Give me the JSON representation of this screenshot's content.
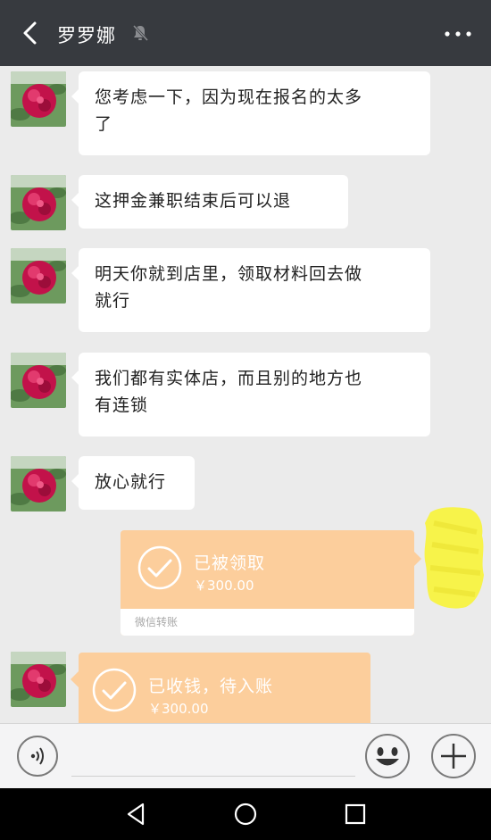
{
  "header": {
    "title": "罗罗娜",
    "back_icon": "back-chevron-icon",
    "mute_icon": "bell-off-icon",
    "more_icon": "more-dots-icon"
  },
  "messages": [
    {
      "type": "text",
      "side": "left",
      "text_lines": [
        "您考虑一下，因为现在报名的太多",
        "了"
      ]
    },
    {
      "type": "text",
      "side": "left",
      "text_lines": [
        "这押金兼职结束后可以退"
      ]
    },
    {
      "type": "text",
      "side": "left",
      "text_lines": [
        "明天你就到店里，领取材料回去做",
        "就行"
      ]
    },
    {
      "type": "text",
      "side": "left",
      "text_lines": [
        "我们都有实体店，而且别的地方也",
        "有连锁"
      ]
    },
    {
      "type": "text",
      "side": "left",
      "text_lines": [
        "放心就行"
      ]
    },
    {
      "type": "transfer",
      "side": "right",
      "status": "已被领取",
      "amount": "￥300.00",
      "footer": "微信转账"
    },
    {
      "type": "transfer",
      "side": "left",
      "status": "已收钱，待入账",
      "amount": "￥300.00"
    }
  ],
  "input_bar": {
    "voice_icon": "voice-icon",
    "emoji_icon": "emoji-icon",
    "plus_icon": "plus-icon"
  },
  "nav_bar": {
    "icons": [
      "nav-back-icon",
      "nav-home-icon",
      "nav-recent-icon"
    ]
  },
  "colors": {
    "topbar": "#373a3f",
    "chat_bg": "#ebebeb",
    "transfer": "#fcce9c",
    "redaction": "#f7f34a"
  }
}
